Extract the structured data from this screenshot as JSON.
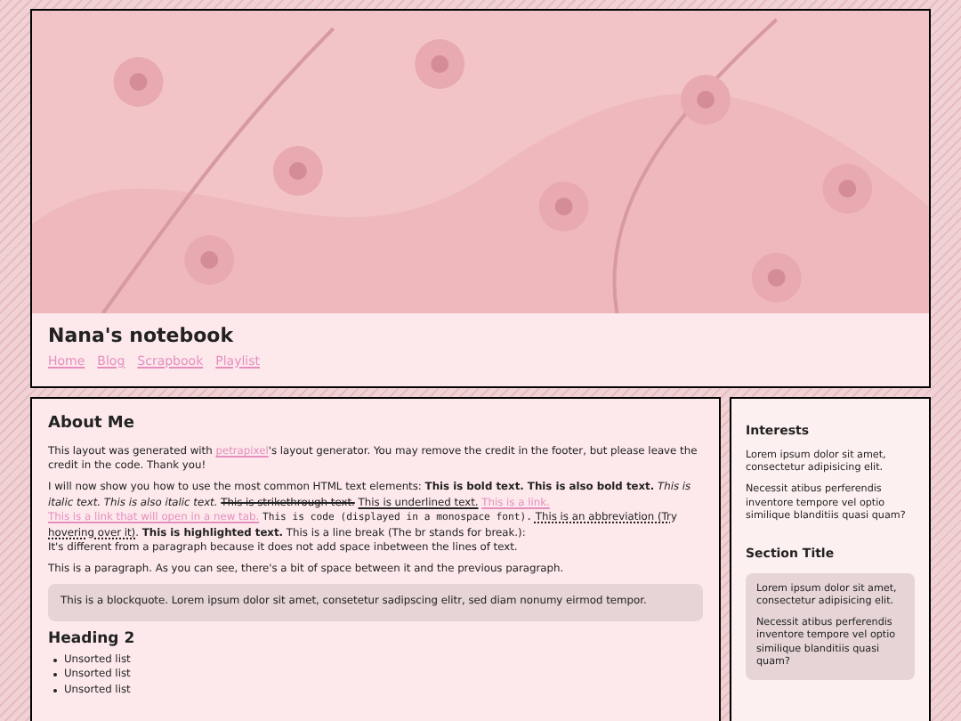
{
  "header": {
    "title": "Nana's notebook",
    "nav": [
      {
        "label": "Home"
      },
      {
        "label": "Blog"
      },
      {
        "label": "Scrapbook"
      },
      {
        "label": "Playlist"
      }
    ]
  },
  "main": {
    "title": "About Me",
    "paragraphs": [
      [
        {
          "kind": "text",
          "text": "This layout was generated with"
        },
        {
          "kind": "link",
          "text": "petrapixel"
        },
        {
          "kind": "suffix",
          "text": "'s layout generator. You may remove the credit in the footer, but please leave the credit in the code. Thank you!"
        }
      ],
      [
        {
          "kind": "text",
          "text": "I will now show you how to use the most common HTML text elements:"
        },
        {
          "kind": "bold",
          "text": "This is bold text. This is also bold text."
        },
        {
          "kind": "italic",
          "text": "This is italic text. This is also italic text."
        },
        {
          "kind": "strike",
          "text": "This is strikethrough text."
        },
        {
          "kind": "underline",
          "text": "This is underlined text."
        },
        {
          "kind": "link",
          "text": "This is a link."
        },
        {
          "kind": "link",
          "text": "This is a link that will open in a new tab."
        },
        {
          "kind": "code",
          "text": "This is code (displayed in a monospace font)."
        },
        {
          "kind": "abbr",
          "text": "This is an abbreviation (Try hovering over it)."
        },
        {
          "kind": "highlight",
          "text": "This is highlighted text."
        },
        {
          "kind": "text",
          "text": "This is a line break (The br stands for break.):"
        },
        {
          "kind": "break",
          "text": "It's different from a paragraph because it does not add space inbetween the lines of text."
        }
      ],
      [
        {
          "kind": "text",
          "text": "This is a paragraph. As you can see, there's a bit of space between it and the previous paragraph."
        }
      ]
    ],
    "blockquote": "This is a blockquote. Lorem ipsum dolor sit amet, consetetur sadipscing elitr, sed diam nonumy eirmod tempor.",
    "heading2": "Heading 2",
    "list": [
      "Unsorted list",
      "Unsorted list",
      "Unsorted list"
    ]
  },
  "sidebar": [
    {
      "title": "Interests",
      "boxed": false,
      "paragraphs": [
        "Lorem ipsum dolor sit amet, consectetur adipisicing elit.",
        "Necessit atibus perferendis inventore tempore vel optio similique blanditiis quasi quam?"
      ]
    },
    {
      "title": "Section Title",
      "boxed": true,
      "paragraphs": [
        "Lorem ipsum dolor sit amet, consectetur adipisicing elit.",
        "Necessit atibus perferendis inventore tempore vel optio similique blanditiis quasi quam?"
      ]
    }
  ]
}
